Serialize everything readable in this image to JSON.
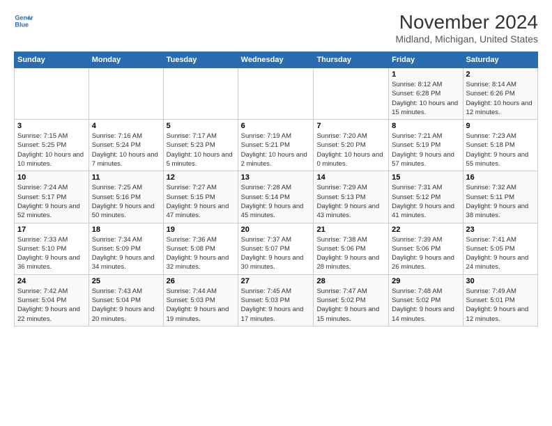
{
  "logo": {
    "line1": "General",
    "line2": "Blue"
  },
  "title": "November 2024",
  "subtitle": "Midland, Michigan, United States",
  "days_of_week": [
    "Sunday",
    "Monday",
    "Tuesday",
    "Wednesday",
    "Thursday",
    "Friday",
    "Saturday"
  ],
  "weeks": [
    [
      {
        "day": "",
        "info": ""
      },
      {
        "day": "",
        "info": ""
      },
      {
        "day": "",
        "info": ""
      },
      {
        "day": "",
        "info": ""
      },
      {
        "day": "",
        "info": ""
      },
      {
        "day": "1",
        "info": "Sunrise: 8:12 AM\nSunset: 6:28 PM\nDaylight: 10 hours and 15 minutes."
      },
      {
        "day": "2",
        "info": "Sunrise: 8:14 AM\nSunset: 6:26 PM\nDaylight: 10 hours and 12 minutes."
      }
    ],
    [
      {
        "day": "3",
        "info": "Sunrise: 7:15 AM\nSunset: 5:25 PM\nDaylight: 10 hours and 10 minutes."
      },
      {
        "day": "4",
        "info": "Sunrise: 7:16 AM\nSunset: 5:24 PM\nDaylight: 10 hours and 7 minutes."
      },
      {
        "day": "5",
        "info": "Sunrise: 7:17 AM\nSunset: 5:23 PM\nDaylight: 10 hours and 5 minutes."
      },
      {
        "day": "6",
        "info": "Sunrise: 7:19 AM\nSunset: 5:21 PM\nDaylight: 10 hours and 2 minutes."
      },
      {
        "day": "7",
        "info": "Sunrise: 7:20 AM\nSunset: 5:20 PM\nDaylight: 10 hours and 0 minutes."
      },
      {
        "day": "8",
        "info": "Sunrise: 7:21 AM\nSunset: 5:19 PM\nDaylight: 9 hours and 57 minutes."
      },
      {
        "day": "9",
        "info": "Sunrise: 7:23 AM\nSunset: 5:18 PM\nDaylight: 9 hours and 55 minutes."
      }
    ],
    [
      {
        "day": "10",
        "info": "Sunrise: 7:24 AM\nSunset: 5:17 PM\nDaylight: 9 hours and 52 minutes."
      },
      {
        "day": "11",
        "info": "Sunrise: 7:25 AM\nSunset: 5:16 PM\nDaylight: 9 hours and 50 minutes."
      },
      {
        "day": "12",
        "info": "Sunrise: 7:27 AM\nSunset: 5:15 PM\nDaylight: 9 hours and 47 minutes."
      },
      {
        "day": "13",
        "info": "Sunrise: 7:28 AM\nSunset: 5:14 PM\nDaylight: 9 hours and 45 minutes."
      },
      {
        "day": "14",
        "info": "Sunrise: 7:29 AM\nSunset: 5:13 PM\nDaylight: 9 hours and 43 minutes."
      },
      {
        "day": "15",
        "info": "Sunrise: 7:31 AM\nSunset: 5:12 PM\nDaylight: 9 hours and 41 minutes."
      },
      {
        "day": "16",
        "info": "Sunrise: 7:32 AM\nSunset: 5:11 PM\nDaylight: 9 hours and 38 minutes."
      }
    ],
    [
      {
        "day": "17",
        "info": "Sunrise: 7:33 AM\nSunset: 5:10 PM\nDaylight: 9 hours and 36 minutes."
      },
      {
        "day": "18",
        "info": "Sunrise: 7:34 AM\nSunset: 5:09 PM\nDaylight: 9 hours and 34 minutes."
      },
      {
        "day": "19",
        "info": "Sunrise: 7:36 AM\nSunset: 5:08 PM\nDaylight: 9 hours and 32 minutes."
      },
      {
        "day": "20",
        "info": "Sunrise: 7:37 AM\nSunset: 5:07 PM\nDaylight: 9 hours and 30 minutes."
      },
      {
        "day": "21",
        "info": "Sunrise: 7:38 AM\nSunset: 5:06 PM\nDaylight: 9 hours and 28 minutes."
      },
      {
        "day": "22",
        "info": "Sunrise: 7:39 AM\nSunset: 5:06 PM\nDaylight: 9 hours and 26 minutes."
      },
      {
        "day": "23",
        "info": "Sunrise: 7:41 AM\nSunset: 5:05 PM\nDaylight: 9 hours and 24 minutes."
      }
    ],
    [
      {
        "day": "24",
        "info": "Sunrise: 7:42 AM\nSunset: 5:04 PM\nDaylight: 9 hours and 22 minutes."
      },
      {
        "day": "25",
        "info": "Sunrise: 7:43 AM\nSunset: 5:04 PM\nDaylight: 9 hours and 20 minutes."
      },
      {
        "day": "26",
        "info": "Sunrise: 7:44 AM\nSunset: 5:03 PM\nDaylight: 9 hours and 19 minutes."
      },
      {
        "day": "27",
        "info": "Sunrise: 7:45 AM\nSunset: 5:03 PM\nDaylight: 9 hours and 17 minutes."
      },
      {
        "day": "28",
        "info": "Sunrise: 7:47 AM\nSunset: 5:02 PM\nDaylight: 9 hours and 15 minutes."
      },
      {
        "day": "29",
        "info": "Sunrise: 7:48 AM\nSunset: 5:02 PM\nDaylight: 9 hours and 14 minutes."
      },
      {
        "day": "30",
        "info": "Sunrise: 7:49 AM\nSunset: 5:01 PM\nDaylight: 9 hours and 12 minutes."
      }
    ]
  ]
}
